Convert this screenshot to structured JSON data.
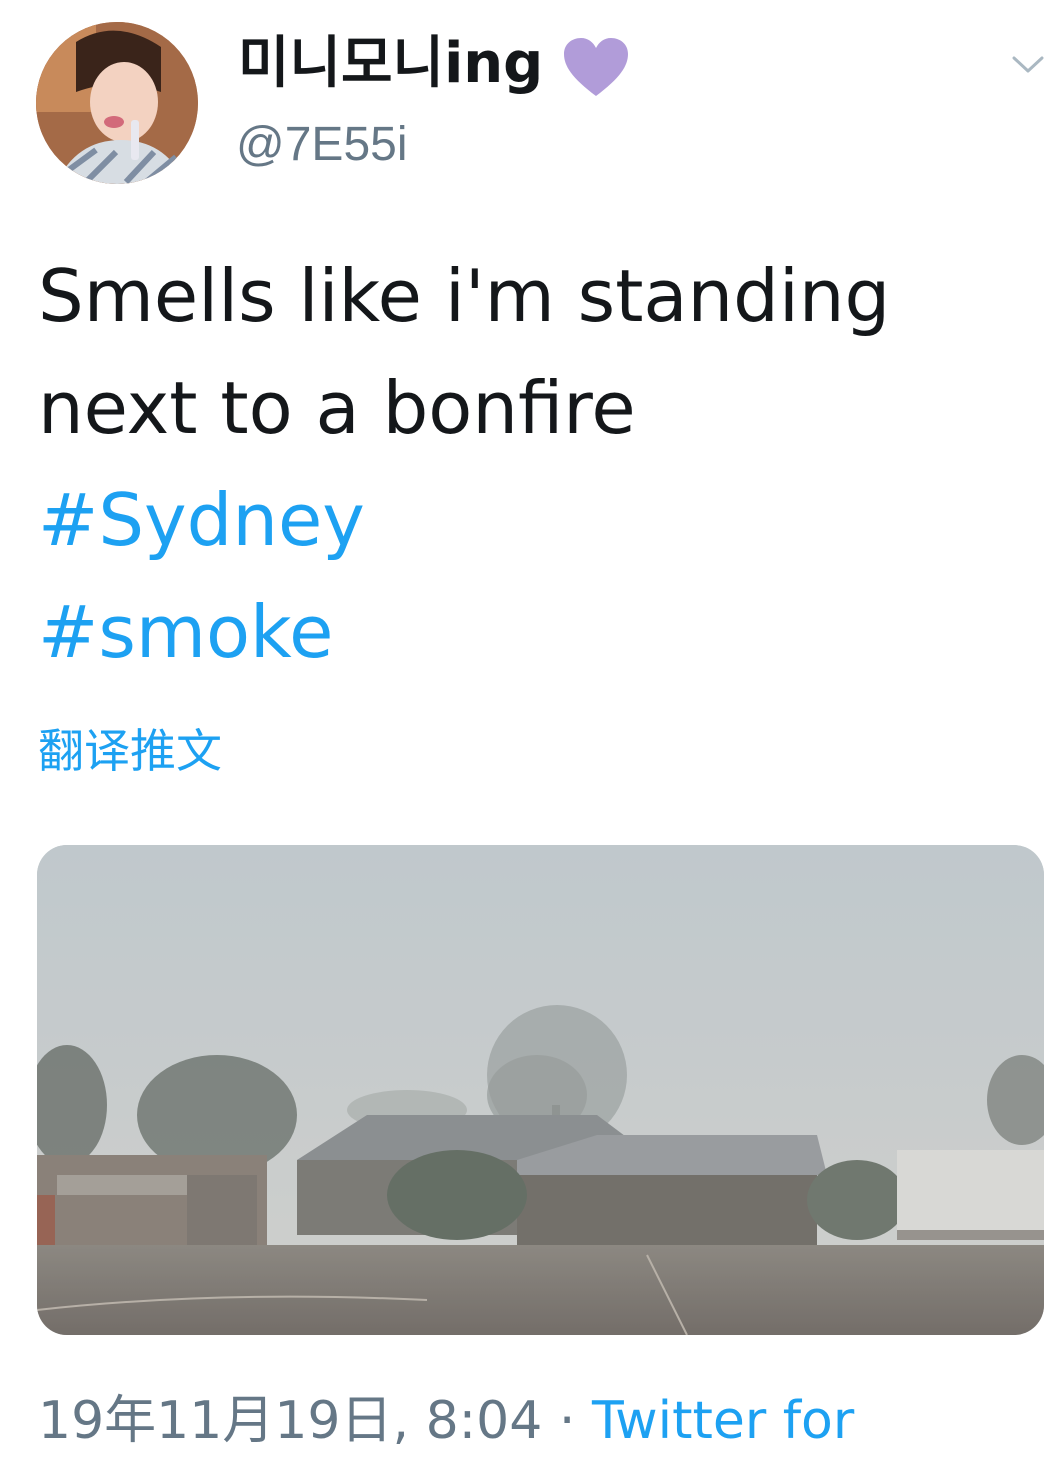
{
  "author": {
    "display_name": "미니모니ing",
    "badge_icon": "purple-heart-icon",
    "handle": "@7E55i"
  },
  "tweet": {
    "lines": [
      "Smells like i'm standing",
      "next to a bonfire"
    ],
    "hashtags": [
      "#Sydney",
      "#smoke"
    ],
    "translate_label": "翻译推文"
  },
  "media": {
    "type": "photo"
  },
  "meta": {
    "timestamp": "19年11月19日, 8:04",
    "separator": "·",
    "source": "Twitter for"
  },
  "colors": {
    "link": "#1da1f2",
    "secondary": "#657786",
    "heart": "#b19cd9"
  }
}
